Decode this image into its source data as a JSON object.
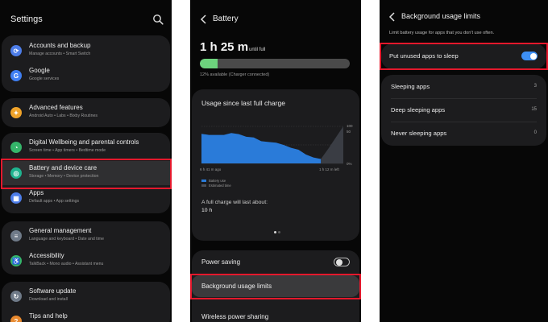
{
  "settings": {
    "title": "Settings",
    "items": [
      {
        "title": "Accounts and backup",
        "subtitle": "Manage accounts  •  Smart Switch"
      },
      {
        "title": "Google",
        "subtitle": "Google services"
      },
      {
        "title": "Advanced features",
        "subtitle": "Android Auto  •  Labs  •  Bixby Routines"
      },
      {
        "title": "Digital Wellbeing and parental controls",
        "subtitle": "Screen time  •  App timers  •  Bedtime mode"
      },
      {
        "title": "Battery and device care",
        "subtitle": "Storage  •  Memory  •  Device protection"
      },
      {
        "title": "Apps",
        "subtitle": "Default apps  •  App settings"
      },
      {
        "title": "General management",
        "subtitle": "Language and keyboard  •  Date and time"
      },
      {
        "title": "Accessibility",
        "subtitle": "TalkBack  •  Mono audio  •  Assistant menu"
      },
      {
        "title": "Software update",
        "subtitle": "Download and install"
      },
      {
        "title": "Tips and help",
        "subtitle": ""
      }
    ]
  },
  "battery": {
    "title": "Battery",
    "time_left": "1 h 25 m",
    "until_full": "until full",
    "level_percent": 12,
    "available_text": "12% available (Charger connected)",
    "usage_card_title": "Usage since last full charge",
    "full_charge_label": "A full charge will last about:",
    "full_charge_value": "10 h",
    "power_saving_label": "Power saving",
    "power_saving_on": false,
    "background_label": "Background usage limits",
    "wireless_label": "Wireless power sharing"
  },
  "chart_data": {
    "type": "area",
    "title": "Usage since last full charge",
    "x_start_label": "6 h 41 m ago",
    "x_end_label": "1 h 12 m left",
    "y_tick_labels": [
      "100",
      "50",
      "0%"
    ],
    "ylim": [
      0,
      100
    ],
    "series": [
      {
        "name": "Battery use",
        "values": [
          80,
          77,
          77,
          77,
          82,
          79,
          72,
          70,
          60,
          58,
          56,
          50,
          42,
          37,
          24,
          16,
          12
        ]
      },
      {
        "name": "Estimated time",
        "values": [
          12,
          40,
          70,
          100
        ]
      }
    ],
    "legend": [
      "Battery use",
      "Estimated time"
    ],
    "colors": {
      "battery_use": "#2a7bd9",
      "estimated_time": "#3a3d44"
    }
  },
  "background_limits": {
    "title": "Background usage limits",
    "description": "Limit battery usage for apps that you don't use often.",
    "sleep_label": "Put unused apps to sleep",
    "sleep_on": true,
    "rows": [
      {
        "label": "Sleeping apps",
        "count": "3"
      },
      {
        "label": "Deep sleeping apps",
        "count": "15"
      },
      {
        "label": "Never sleeping apps",
        "count": "0"
      }
    ]
  },
  "colors": {
    "highlight": "#e4182c",
    "toggle_on": "#3d8ff5",
    "battery_fill": "#6dd37d"
  }
}
